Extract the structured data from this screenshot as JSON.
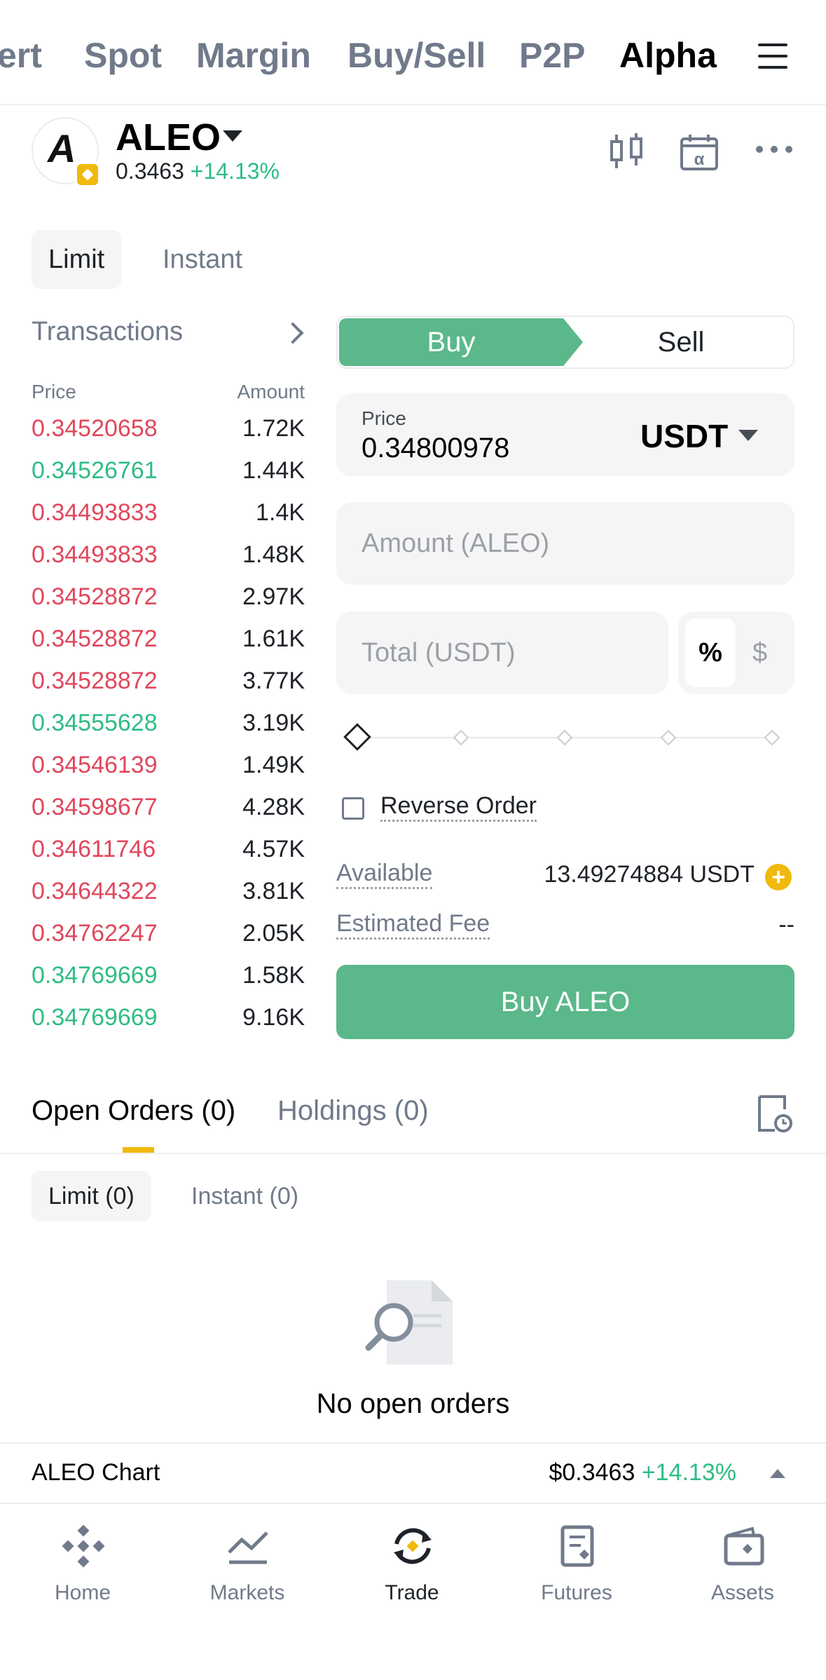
{
  "top_tabs": [
    "ert",
    "Spot",
    "Margin",
    "Buy/Sell",
    "P2P",
    "Alpha"
  ],
  "header": {
    "symbol": "ALEO",
    "price": "0.3463",
    "change": "+14.13%",
    "logo_glyph": "A"
  },
  "order_types": [
    "Limit",
    "Instant"
  ],
  "orderbook": {
    "title": "Transactions",
    "price_header": "Price",
    "amount_header": "Amount",
    "rows": [
      {
        "price": "0.34520658",
        "amount": "1.72K",
        "side": "sell"
      },
      {
        "price": "0.34526761",
        "amount": "1.44K",
        "side": "buy"
      },
      {
        "price": "0.34493833",
        "amount": "1.4K",
        "side": "sell"
      },
      {
        "price": "0.34493833",
        "amount": "1.48K",
        "side": "sell"
      },
      {
        "price": "0.34528872",
        "amount": "2.97K",
        "side": "sell"
      },
      {
        "price": "0.34528872",
        "amount": "1.61K",
        "side": "sell"
      },
      {
        "price": "0.34528872",
        "amount": "3.77K",
        "side": "sell"
      },
      {
        "price": "0.34555628",
        "amount": "3.19K",
        "side": "buy"
      },
      {
        "price": "0.34546139",
        "amount": "1.49K",
        "side": "sell"
      },
      {
        "price": "0.34598677",
        "amount": "4.28K",
        "side": "sell"
      },
      {
        "price": "0.34611746",
        "amount": "4.57K",
        "side": "sell"
      },
      {
        "price": "0.34644322",
        "amount": "3.81K",
        "side": "sell"
      },
      {
        "price": "0.34762247",
        "amount": "2.05K",
        "side": "sell"
      },
      {
        "price": "0.34769669",
        "amount": "1.58K",
        "side": "buy"
      },
      {
        "price": "0.34769669",
        "amount": "9.16K",
        "side": "buy"
      }
    ]
  },
  "form": {
    "buy_label": "Buy",
    "sell_label": "Sell",
    "price_label": "Price",
    "price_value": "0.34800978",
    "quote_currency": "USDT",
    "amount_placeholder": "Amount (ALEO)",
    "total_placeholder": "Total (USDT)",
    "pct_label": "%",
    "usd_label": "$",
    "slider_percent": 0,
    "reverse_order_label": "Reverse Order",
    "available_label": "Available",
    "available_value": "13.49274884 USDT",
    "fee_label": "Estimated Fee",
    "fee_value": "--",
    "submit_label": "Buy ALEO"
  },
  "orders": {
    "tabs": [
      "Open Orders (0)",
      "Holdings (0)"
    ],
    "subtabs": [
      "Limit (0)",
      "Instant (0)"
    ],
    "empty_text": "No open orders"
  },
  "chart_bar": {
    "label": "ALEO Chart",
    "price": "$0.3463",
    "change": "+14.13%"
  },
  "bottom_nav": [
    {
      "label": "Home",
      "icon": "binance-logo-icon"
    },
    {
      "label": "Markets",
      "icon": "chart-line-icon"
    },
    {
      "label": "Trade",
      "icon": "trade-swap-icon"
    },
    {
      "label": "Futures",
      "icon": "futures-doc-icon"
    },
    {
      "label": "Assets",
      "icon": "wallet-icon"
    }
  ],
  "colors": {
    "buy": "#5bb88a",
    "sell": "#e0475b",
    "accent": "#f0b90b"
  }
}
